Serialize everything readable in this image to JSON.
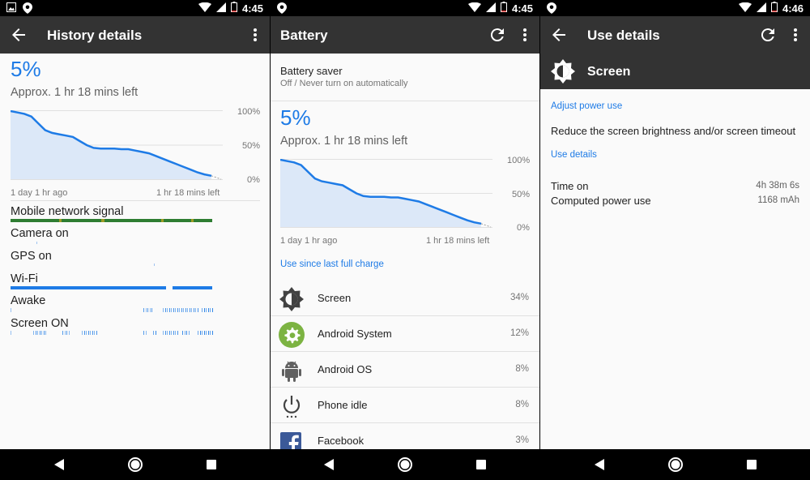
{
  "status": {
    "times": [
      "4:45",
      "4:45",
      "4:46"
    ]
  },
  "history": {
    "title": "History details",
    "percent": "5%",
    "approx": "Approx. 1 hr 18 mins left",
    "axis": {
      "y100": "100%",
      "y50": "50%",
      "y0": "0%",
      "x_start": "1 day 1 hr ago",
      "x_end": "1 hr 18 mins left"
    },
    "rows": [
      "Mobile network signal",
      "Camera on",
      "GPS on",
      "Wi-Fi",
      "Awake",
      "Screen ON"
    ]
  },
  "battery": {
    "title": "Battery",
    "saver_title": "Battery saver",
    "saver_sub": "Off / Never turn on automatically",
    "percent": "5%",
    "approx": "Approx. 1 hr 18 mins left",
    "axis": {
      "y100": "100%",
      "y50": "50%",
      "y0": "0%",
      "x_start": "1 day 1 hr ago",
      "x_end": "1 hr 18 mins left"
    },
    "use_since": "Use since last full charge",
    "apps": [
      {
        "name": "Screen",
        "pct": "34%",
        "icon": "brightness-icon"
      },
      {
        "name": "Android System",
        "pct": "12%",
        "icon": "android-system-gear-icon"
      },
      {
        "name": "Android OS",
        "pct": "8%",
        "icon": "android-robot-icon"
      },
      {
        "name": "Phone idle",
        "pct": "8%",
        "icon": "power-icon"
      },
      {
        "name": "Facebook",
        "pct": "3%",
        "icon": "facebook-icon"
      }
    ]
  },
  "use_details": {
    "title": "Use details",
    "item_title": "Screen",
    "adjust": "Adjust power use",
    "reduce": "Reduce the screen brightness and/or screen timeout",
    "use_details_label": "Use details",
    "time_on_label": "Time on",
    "time_on_value": "4h 38m 6s",
    "computed_label": "Computed power use",
    "computed_value": "1168 mAh"
  },
  "colors": {
    "accent": "#1e7be6",
    "appbar": "#333333",
    "signal": "#2e7d32",
    "gear": "#7cb342"
  },
  "curve": {
    "battery_levels": [
      100,
      98,
      96,
      92,
      82,
      72,
      68,
      66,
      64,
      62,
      56,
      50,
      46,
      45,
      45,
      45,
      44,
      44,
      42,
      40,
      38,
      34,
      30,
      26,
      22,
      18,
      14,
      10,
      7,
      5
    ]
  }
}
